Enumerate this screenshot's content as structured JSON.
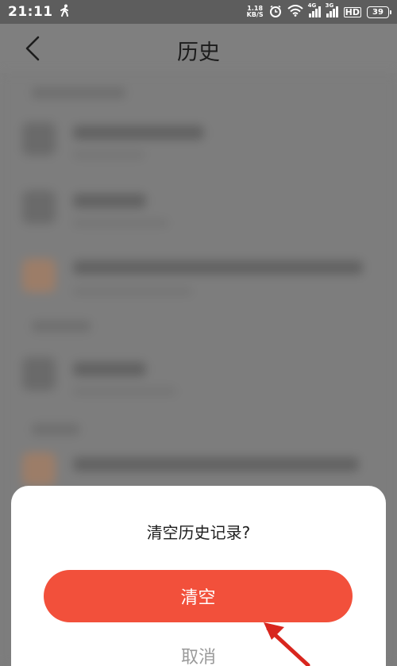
{
  "status_bar": {
    "time": "21:11",
    "net_speed_value": "1.18",
    "net_speed_unit": "KB/S",
    "sig1_tag": "4G",
    "sig2_tag": "3G",
    "hd": "HD",
    "battery": "39",
    "icons": [
      "walk-icon",
      "alarm-icon",
      "wifi-icon",
      "signal-icon",
      "battery-icon"
    ]
  },
  "header": {
    "title": "历史",
    "back_icon": "chevron-left-icon"
  },
  "dialog": {
    "title": "清空历史记录?",
    "confirm_label": "清空",
    "cancel_label": "取消"
  },
  "colors": {
    "accent": "#f2503b",
    "overlay": "#7d7d7d",
    "sheet": "#ffffff",
    "arrow": "#d8261e"
  }
}
